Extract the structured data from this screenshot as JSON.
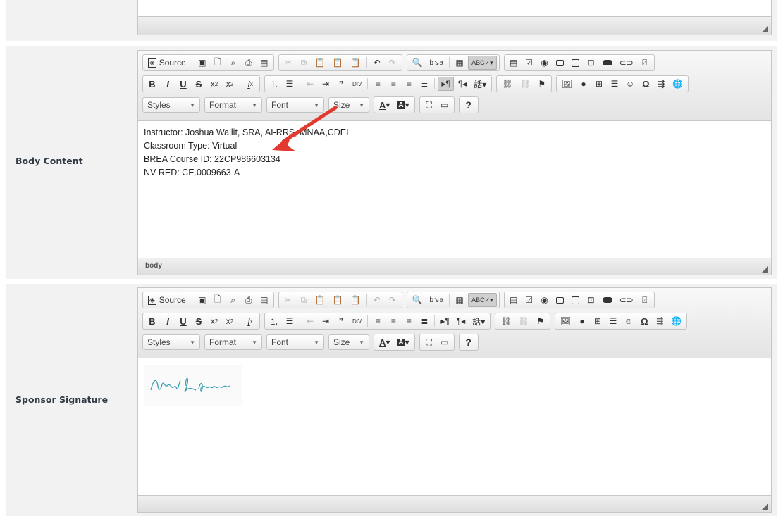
{
  "toolbar": {
    "source_label": "Source",
    "styles_label": "Styles",
    "format_label": "Format",
    "font_label": "Font",
    "size_label": "Size",
    "help_label": "?"
  },
  "rows": {
    "body_content": {
      "label": "Body Content",
      "lines": [
        "Instructor: Joshua Wallit, SRA, AI-RRS, MNAA,CDEI",
        "Classroom Type:  Virtual",
        "BREA Course ID: 22CP986603134",
        "NV RED: CE.0009663-A"
      ],
      "status_path": "body"
    },
    "sponsor_signature": {
      "label": "Sponsor Signature",
      "signature_text": "Amy L Parker"
    }
  },
  "colors": {
    "row_background": "#f2f2f2",
    "toolbar_gradient_top": "#f8f8f8",
    "annotation_arrow": "#e23a2f",
    "signature_ink": "#3a9fb5"
  },
  "icons": {
    "annotation": "red-arrow-icon"
  }
}
